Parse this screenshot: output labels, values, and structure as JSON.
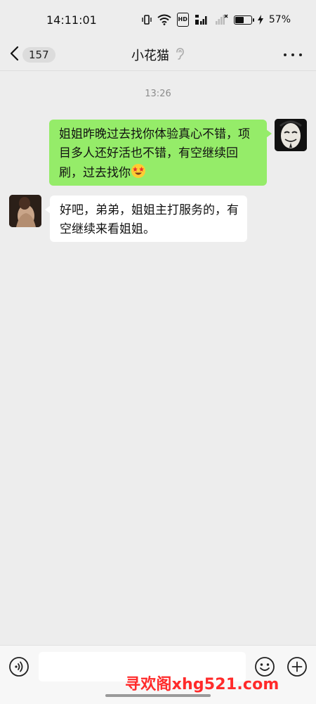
{
  "status_bar": {
    "time": "14:11:01",
    "battery_percent": "57%",
    "battery_level": 0.57,
    "hd_label": "HD"
  },
  "header": {
    "back_count": "157",
    "title": "小花猫"
  },
  "chat": {
    "timestamp": "13:26",
    "messages": [
      {
        "side": "right",
        "text": "姐姐昨晚过去找你体验真心不错，项目多人还好活也不错，有空继续回刷，过去找你",
        "emoji": "star-struck-emoji",
        "bubble_color": "#95ec69"
      },
      {
        "side": "left",
        "text": "好吧，弟弟，姐姐主打服务的，有空继续来看姐姐。",
        "bubble_color": "#ffffff"
      }
    ]
  },
  "input_bar": {
    "value": "",
    "placeholder": ""
  },
  "watermark": "寻欢阁xhg521.com",
  "colors": {
    "background": "#ededed",
    "sent_bubble": "#95ec69",
    "received_bubble": "#ffffff",
    "watermark": "#ff2a2a"
  }
}
